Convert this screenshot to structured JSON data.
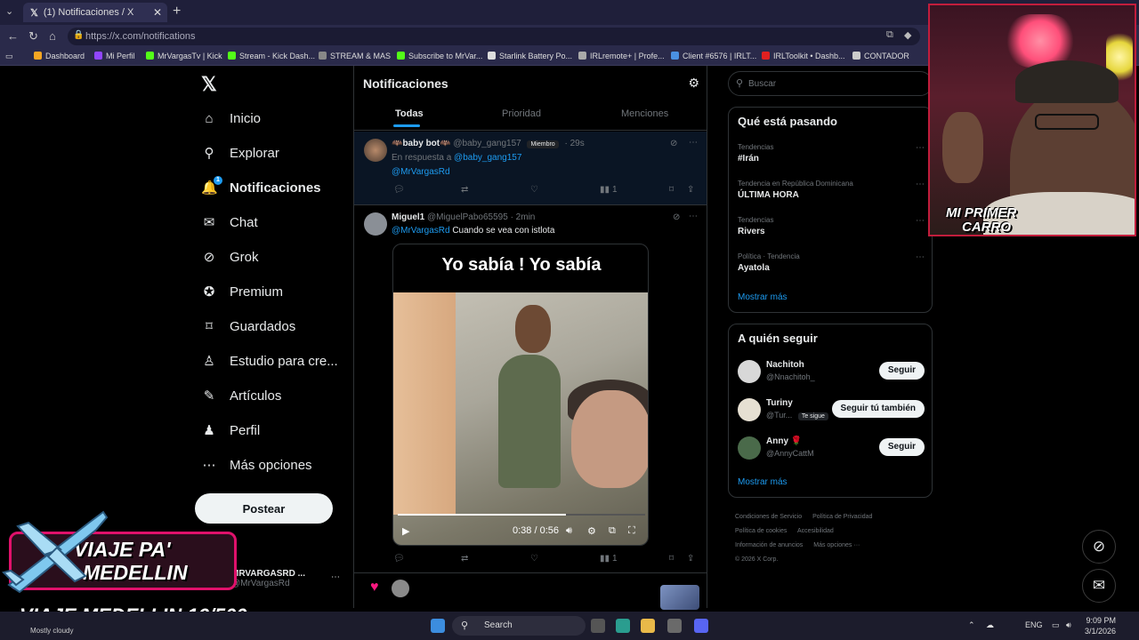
{
  "browser": {
    "tab_title": "(1) Notificaciones / X",
    "tab_close": "✕",
    "new_tab": "+",
    "url": "https://x.com/notifications",
    "bookmarks": [
      "Dashboard",
      "Mi Perfil",
      "MrVargasTv | Kick",
      "Stream - Kick Dash...",
      "STREAM & MAS",
      "Subscribe to MrVar...",
      "Starlink Battery Po...",
      "IRLremote+ | Profe...",
      "Client #6576 | IRLT...",
      "IRLToolkit • Dashb...",
      "CONTADOR"
    ]
  },
  "nav": {
    "items": [
      {
        "label": "Inicio",
        "icon": "home-icon"
      },
      {
        "label": "Explorar",
        "icon": "search-icon"
      },
      {
        "label": "Notificaciones",
        "icon": "bell-icon",
        "badge": "1"
      },
      {
        "label": "Chat",
        "icon": "mail-icon"
      },
      {
        "label": "Grok",
        "icon": "grok-icon"
      },
      {
        "label": "Premium",
        "icon": "verified-icon"
      },
      {
        "label": "Guardados",
        "icon": "bookmark-icon"
      },
      {
        "label": "Estudio para cre...",
        "icon": "studio-icon"
      },
      {
        "label": "Artículos",
        "icon": "article-icon"
      },
      {
        "label": "Perfil",
        "icon": "person-icon"
      },
      {
        "label": "Más opciones",
        "icon": "more-icon"
      }
    ],
    "post_label": "Postear",
    "account_name": "MRVARGASRD ...",
    "account_handle": "@MrVargasRd"
  },
  "notifications": {
    "title": "Notificaciones",
    "tabs": [
      "Todas",
      "Prioridad",
      "Menciones"
    ],
    "post1": {
      "name": "🦇baby bot🦇",
      "handle": "@baby_gang157",
      "member": "Miembro",
      "time": "· 29s",
      "reply_prefix": "En respuesta a",
      "reply_to": "@baby_gang157",
      "mention": "@MrVargasRd",
      "views": "1"
    },
    "post2": {
      "name": "Miguel1",
      "handle": "@MiguelPabo65595",
      "time": "· 2min",
      "mention": "@MrVargasRd",
      "text": "Cuando se vea con istlota",
      "video_caption": "Yo sabía ! Yo sabía",
      "video_time": "0:38 / 0:56",
      "video_progress": 0.68,
      "views": "1"
    }
  },
  "sidebar": {
    "search_placeholder": "Buscar",
    "trends_title": "Qué está pasando",
    "trends": [
      {
        "category": "Tendencias",
        "name": "#Irán"
      },
      {
        "category": "Tendencia en República Dominicana",
        "name": "ÚLTIMA HORA"
      },
      {
        "category": "Tendencias",
        "name": "Rivers"
      },
      {
        "category": "Política · Tendencia",
        "name": "Ayatola"
      }
    ],
    "trends_more": "Mostrar más",
    "follow_title": "A quién seguir",
    "follow": [
      {
        "name": "Nachitoh",
        "handle": "@Nnachitoh_",
        "button": "Seguir"
      },
      {
        "name": "Turiny",
        "handle": "@Tur...",
        "follows_you": "Te sigue",
        "button": "Seguir tú también"
      },
      {
        "name": "Anny 🌹",
        "handle": "@AnnyCattM",
        "button": "Seguir"
      }
    ],
    "follow_more": "Mostrar más",
    "footer": [
      "Condiciones de Servicio",
      "Política de Privacidad",
      "Política de cookies",
      "Accesibilidad",
      "Información de anuncios",
      "Más opciones ···",
      "© 2026 X Corp."
    ]
  },
  "overlay": {
    "cam_tag_line1": "MI PRIMER",
    "cam_tag_line2": "CARRO",
    "trip_line1": "VIAJE PA'",
    "trip_line2": "MEDELLIN",
    "trip_count": "VIAJE MEDELLIN 16/500"
  },
  "taskbar": {
    "weather": "Mostly cloudy",
    "search": "Search",
    "lang": "ENG",
    "time": "9:09 PM",
    "date": "3/1/2026"
  },
  "colors": {
    "accent": "#1d9bf0",
    "like": "#f91880",
    "overlay_border": "#e0116b",
    "cam_border": "#c21d3c"
  }
}
